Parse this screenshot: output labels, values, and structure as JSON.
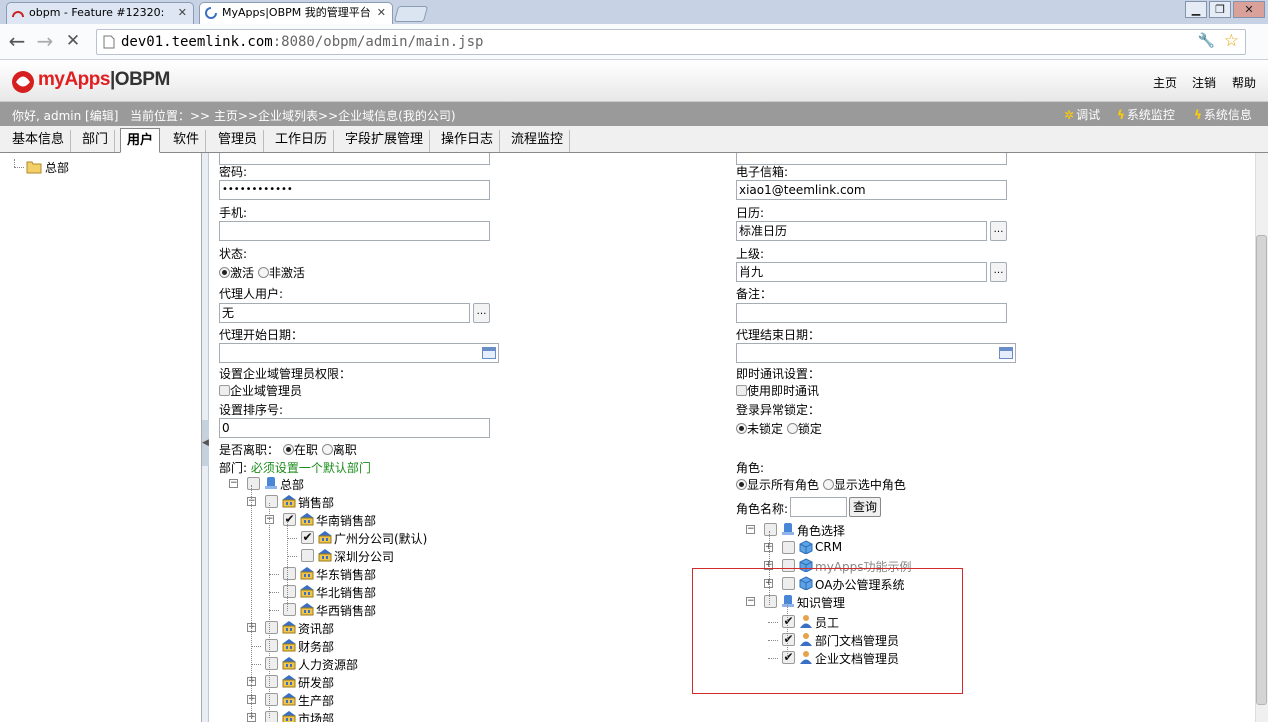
{
  "browser": {
    "tabs": [
      {
        "title": "obpm - Feature #12320:",
        "active": false
      },
      {
        "title": "MyApps|OBPM 我的管理平台",
        "active": true
      }
    ],
    "url_host": "dev01.teemlink.com",
    "url_path": ":8080/obpm/admin/main.jsp"
  },
  "header": {
    "logo_my": "myApps",
    "logo_rest": "|OBPM",
    "links": [
      "主页",
      "注销",
      "帮助"
    ]
  },
  "infobar": {
    "greeting": "你好, admin [编辑]",
    "breadcrumb": "当前位置：>> 主页>>企业域列表>>企业域信息(我的公司)",
    "buttons": [
      "调试",
      "系统监控",
      "系统信息"
    ]
  },
  "tabs": [
    "基本信息",
    "部门",
    "用户",
    "软件",
    "管理员",
    "工作日历",
    "字段扩展管理",
    "操作日志",
    "流程监控"
  ],
  "active_tab": "用户",
  "left_tree": {
    "root": "总部"
  },
  "form": {
    "password_label": "密码:",
    "password_value": "••••••••••••",
    "mobile_label": "手机:",
    "status_label": "状态:",
    "status_active": "激活",
    "status_inactive": "非激活",
    "proxy_user_label": "代理人用户:",
    "proxy_user_value": "无",
    "proxy_start_label": "代理开始日期：",
    "admin_perm_label": "设置企业域管理员权限：",
    "admin_perm_option": "企业域管理员",
    "sort_label": "设置排序号:",
    "sort_value": "0",
    "resigned_label": "是否离职：",
    "resigned_in": "在职",
    "resigned_out": "离职",
    "dept_label": "部门:",
    "dept_note": "必须设置一个默认部门",
    "email_label": "电子信箱:",
    "email_value": "xiao1@teemlink.com",
    "calendar_label": "日历:",
    "calendar_value": "标准日历",
    "superior_label": "上级:",
    "superior_value": "肖九",
    "remark_label": "备注：",
    "proxy_end_label": "代理结束日期：",
    "im_label": "即时通讯设置：",
    "im_option": "使用即时通讯",
    "lock_label": "登录异常锁定：",
    "lock_no": "未锁定",
    "lock_yes": "锁定",
    "role_label": "角色:",
    "role_show_all": "显示所有角色",
    "role_show_selected": "显示选中角色",
    "role_name_label": "角色名称:",
    "query_button": "查询"
  },
  "dept_tree": [
    {
      "label": "总部"
    },
    {
      "label": "销售部"
    },
    {
      "label": "华南销售部"
    },
    {
      "label": "广州分公司(默认)"
    },
    {
      "label": "深圳分公司"
    },
    {
      "label": "华东销售部"
    },
    {
      "label": "华北销售部"
    },
    {
      "label": "华西销售部"
    },
    {
      "label": "资讯部"
    },
    {
      "label": "财务部"
    },
    {
      "label": "人力资源部"
    },
    {
      "label": "研发部"
    },
    {
      "label": "生产部"
    },
    {
      "label": "市场部"
    }
  ],
  "role_tree": [
    {
      "label": "角色选择"
    },
    {
      "label": "CRM"
    },
    {
      "label": "myApps功能示例"
    },
    {
      "label": "OA办公管理系统"
    },
    {
      "label": "知识管理"
    },
    {
      "label": "员工"
    },
    {
      "label": "部门文档管理员"
    },
    {
      "label": "企业文档管理员"
    }
  ]
}
